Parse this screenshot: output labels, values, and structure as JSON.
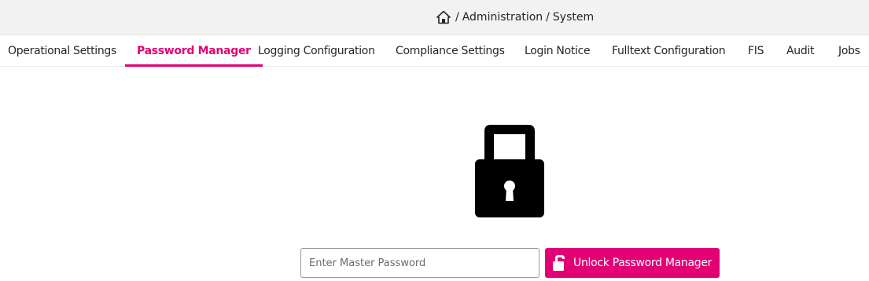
{
  "breadcrumb": {
    "icon": "home-icon",
    "items": [
      "Administration",
      "System"
    ],
    "separator": "/"
  },
  "tabs": [
    {
      "label": "Operational Settings",
      "active": false
    },
    {
      "label": "Password Manager",
      "active": true
    },
    {
      "label": "Logging Configuration",
      "active": false
    },
    {
      "label": "Compliance Settings",
      "active": false
    },
    {
      "label": "Login Notice",
      "active": false
    },
    {
      "label": "Fulltext Configuration",
      "active": false
    },
    {
      "label": "FIS",
      "active": false
    },
    {
      "label": "Audit",
      "active": false
    },
    {
      "label": "Jobs",
      "active": false
    }
  ],
  "lock": {
    "icon": "lock-icon",
    "state": "locked"
  },
  "master_password": {
    "placeholder": "Enter Master Password",
    "value": ""
  },
  "unlock_button": {
    "label": "Unlock Password Manager",
    "icon": "unlock-icon"
  },
  "colors": {
    "accent": "#e20074",
    "breadcrumb_bg": "#f2f2f2",
    "text": "#262626"
  }
}
